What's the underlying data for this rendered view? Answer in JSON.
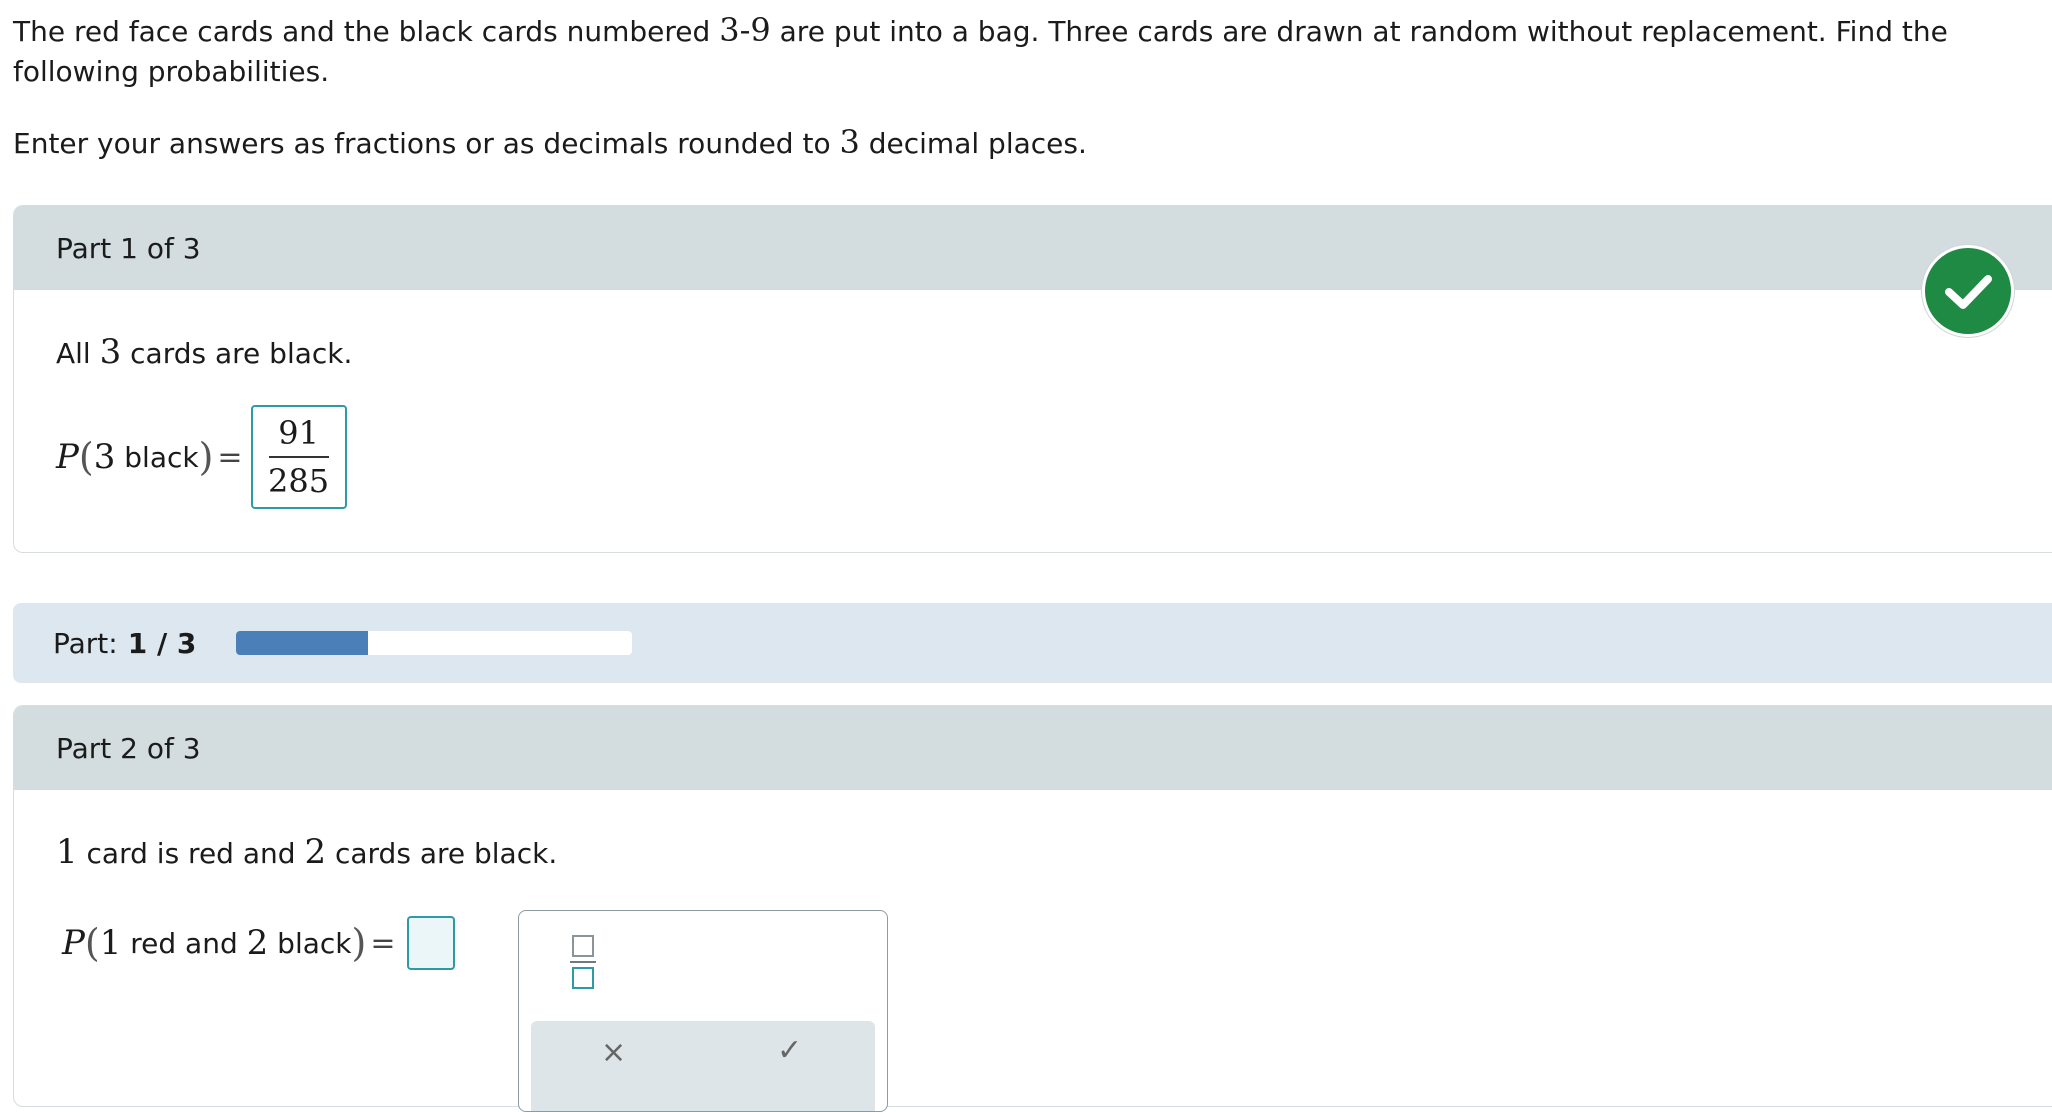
{
  "intro": {
    "line1_a": "The red face cards and the black cards numbered ",
    "line1_num": "3-9",
    "line1_b": " are put into a bag. Three cards are drawn at random without replacement. Find the following probabilities.",
    "line2_a": "Enter your answers as fractions or as decimals rounded to ",
    "line2_num": "3",
    "line2_b": " decimal places."
  },
  "part1": {
    "header": "Part 1 of 3",
    "prompt_pre": "All ",
    "prompt_num": "3",
    "prompt_post": " cards are black.",
    "eq_p": "P",
    "eq_lparen": "(",
    "eq_num": "3",
    "eq_word": " black",
    "eq_rparen": ")",
    "eq_sign": "=",
    "answer_numerator": "91",
    "answer_denominator": "285",
    "status_icon": "check-circle-icon",
    "status_color": "#1f8a43"
  },
  "progress": {
    "label": "Part:",
    "value": "1 / 3",
    "fraction": 0.333,
    "fill_color": "#4a7fb8"
  },
  "part2": {
    "header": "Part 2 of 3",
    "prompt_num1": "1",
    "prompt_mid": " card is red and ",
    "prompt_num2": "2",
    "prompt_post": " cards are black.",
    "eq_p": "P",
    "eq_lparen": "(",
    "eq_num1": "1",
    "eq_word1": " red and ",
    "eq_num2": "2",
    "eq_word2": " black",
    "eq_rparen": ")",
    "eq_sign": "=",
    "input_value": ""
  },
  "toolbox": {
    "tool_icon": "fraction-template-icon",
    "clear_label": "×",
    "check_label": "✓"
  }
}
